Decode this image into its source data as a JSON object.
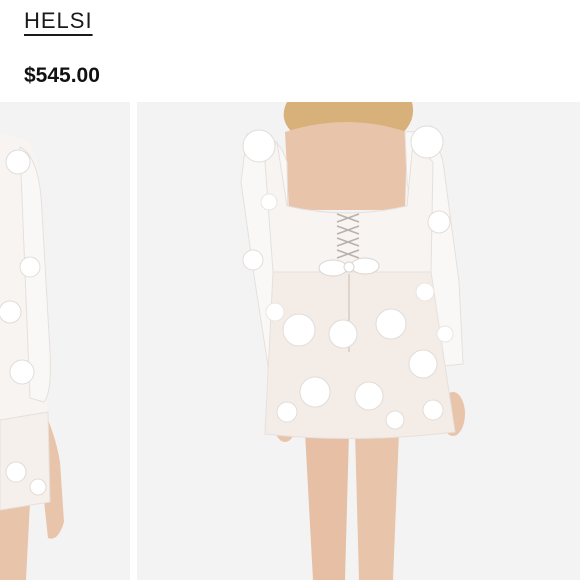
{
  "product": {
    "brand": "HELSI",
    "price": "$545.00"
  },
  "gallery": {
    "images": [
      {
        "name": "previous-product-photo",
        "description_icon": "dress-front-view"
      },
      {
        "name": "current-product-photo",
        "description_icon": "dress-back-view"
      }
    ]
  },
  "colors": {
    "text": "#1a1a1a",
    "photo_bg": "#f3f3f3",
    "dress": "#f7f4f2",
    "skin": "#e8c4ab",
    "hair": "#d8b07a"
  }
}
